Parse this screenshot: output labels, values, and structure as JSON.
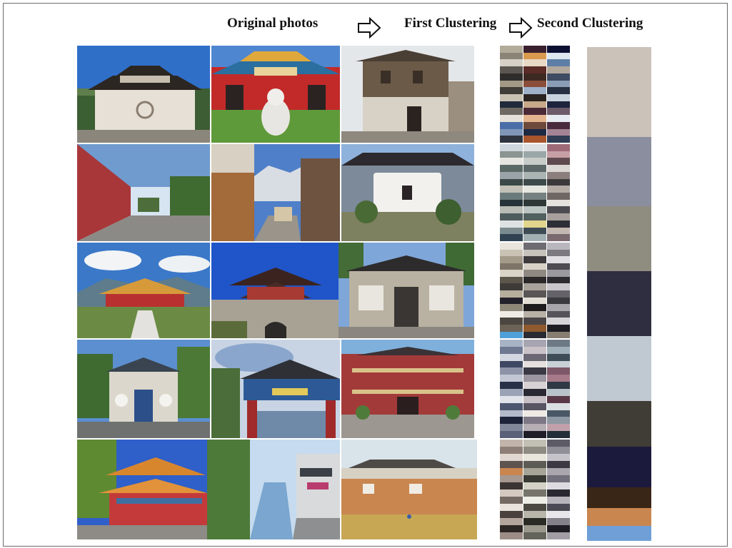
{
  "headers": {
    "original": "Original photos",
    "first": "First Clustering",
    "second": "Second Clustering"
  },
  "icons": {
    "arrow": "hollow-right-arrow-icon"
  },
  "photo_subjects": [
    "white-memorial-archway",
    "red-temple-gate-with-statue",
    "old-wooden-corner-house",
    "red-wall-street",
    "old-town-street-with-mountains",
    "courtyard-screen-wall",
    "temple-complex-with-stairs",
    "city-gate-tower",
    "carved-courtyard-gateway",
    "tiled-archway-among-trees",
    "blue-painted-archway",
    "red-courtyard-building",
    "pagoda-roof-temple",
    "canal-with-ivy-houses",
    "orange-wall-and-field"
  ],
  "first_clustering": [
    [
      "#b3ab9a",
      "#8a8477",
      "#d6d0c6",
      "#5b5650",
      "#2f2d2c",
      "#a39985",
      "#403d39",
      "#c9c2b3",
      "#1f2a3a",
      "#6e6a63",
      "#e6e2da",
      "#4a6fa8",
      "#7f96b8",
      "#2e3440"
    ],
    [
      "#3a1f2e",
      "#d99a4e",
      "#e8d9c5",
      "#5a2b27",
      "#3c2a22",
      "#8a4d3a",
      "#9fb1c8",
      "#2a2320",
      "#c7a98a",
      "#4b2a38",
      "#e2b58f",
      "#6e4a3c",
      "#1e2a44",
      "#a8552d"
    ],
    [
      "#0d0f33",
      "#dfe7ef",
      "#5f7ea6",
      "#b3a89c",
      "#3f4a63",
      "#8b9cb7",
      "#273041",
      "#c9d3de",
      "#1d233c",
      "#6d5b69",
      "#e8ecf0",
      "#4a2b3e",
      "#a48394",
      "#2f3d55"
    ],
    [
      "#cfd6de",
      "#8a9491",
      "#e7e5df",
      "#5a6965",
      "#9aa3a8",
      "#3a4847",
      "#c2c0b6",
      "#6b7a7b",
      "#263338",
      "#b8bcb5",
      "#4f5c5e",
      "#dfe2e3",
      "#7b8a8e",
      "#314352"
    ],
    [
      "#dde1e2",
      "#9aa7a9",
      "#c7ccc8",
      "#5c6867",
      "#aab5b4",
      "#3d4a4a",
      "#e5e6e0",
      "#758180",
      "#2d3736",
      "#bcc4c2",
      "#52605f",
      "#e1d58d",
      "#3f4b55",
      "#a2b0b3"
    ],
    [
      "#9e6a77",
      "#c6a0a6",
      "#5f4a4f",
      "#dcd8d4",
      "#8a7f7c",
      "#3c393b",
      "#b4aca5",
      "#6f6764",
      "#e5e1dc",
      "#4d4b52",
      "#a8a09d",
      "#2e2f36",
      "#c4b8b2",
      "#7a6a70"
    ],
    [
      "#e8e4dc",
      "#c9c1b3",
      "#a49a8a",
      "#7e7568",
      "#d9d3c8",
      "#5c5549",
      "#3d3a38",
      "#b6ad9d",
      "#23212a",
      "#8f8778",
      "#efece6",
      "#4b4740",
      "#6b6357",
      "#4fa0d8"
    ],
    [
      "#6e6c72",
      "#c7c2bb",
      "#3e3b3e",
      "#d7d1c7",
      "#8f8982",
      "#2b2829",
      "#a8a29a",
      "#5a5655",
      "#e4dfd6",
      "#1f1c1e",
      "#b8b1a7",
      "#4b4748",
      "#8e5a2e",
      "#2a2a33"
    ],
    [
      "#b9b7be",
      "#7c7a80",
      "#e1dfe3",
      "#4e4c52",
      "#9b989e",
      "#2d2b30",
      "#cac7cc",
      "#65636a",
      "#3b3a3f",
      "#a8a5ab",
      "#56545a",
      "#d7d4d8",
      "#1e1d22",
      "#867e72"
    ],
    [
      "#a9b3c6",
      "#6f7891",
      "#d3d7e0",
      "#3f4862",
      "#8d94a8",
      "#c2c7d3",
      "#283048",
      "#9aa2b6",
      "#e1e3ea",
      "#4d5670",
      "#b4bac9",
      "#1d2439",
      "#7f8799",
      "#5a6078"
    ],
    [
      "#a8a5b3",
      "#c9c3c8",
      "#6b6874",
      "#e5e0dd",
      "#3a3944",
      "#9b95a0",
      "#d8d2d4",
      "#2a2833",
      "#c6c0c4",
      "#585563",
      "#efe9e5",
      "#7c7886",
      "#b5aeb5",
      "#1f1d27"
    ],
    [
      "#6d7a86",
      "#9fb0b9",
      "#3e4c57",
      "#c8d1d6",
      "#7e5868",
      "#a67a88",
      "#2f3945",
      "#b8c3c9",
      "#5a3848",
      "#d9dfe2",
      "#4a5865",
      "#8e98a3",
      "#c0a0aa",
      "#243039"
    ],
    [
      "#c1b5ab",
      "#8d7f77",
      "#e0d8d0",
      "#5e534e",
      "#c9864f",
      "#a69890",
      "#3b3432",
      "#d4c9c0",
      "#756a64",
      "#e9e3dc",
      "#4a403c",
      "#b3a59c",
      "#2c2624",
      "#9c8e86"
    ],
    [
      "#c2bfb4",
      "#8e8c82",
      "#e8e6dc",
      "#5d5c54",
      "#a7a598",
      "#3a3a34",
      "#d4d2c6",
      "#76756b",
      "#efeee6",
      "#4a4a42",
      "#b8b6aa",
      "#2b2b26",
      "#9b998d",
      "#64635b"
    ],
    [
      "#5d5c66",
      "#908e97",
      "#c5c3c9",
      "#3b3a43",
      "#a9a6ad",
      "#72707a",
      "#dedbe0",
      "#2a2931",
      "#b7b4bb",
      "#4c4a54",
      "#e8e6ea",
      "#838089",
      "#1e1d24",
      "#a09da5"
    ]
  ],
  "second_clustering": [
    "#cbc2b9",
    "#8a8e9e",
    "#8f8d80",
    "#2f2d40",
    "#c0c9d2",
    "#3f3d35",
    "#1c1a3c",
    "#3a2617",
    "#c9864f",
    "#6f9fd6"
  ]
}
